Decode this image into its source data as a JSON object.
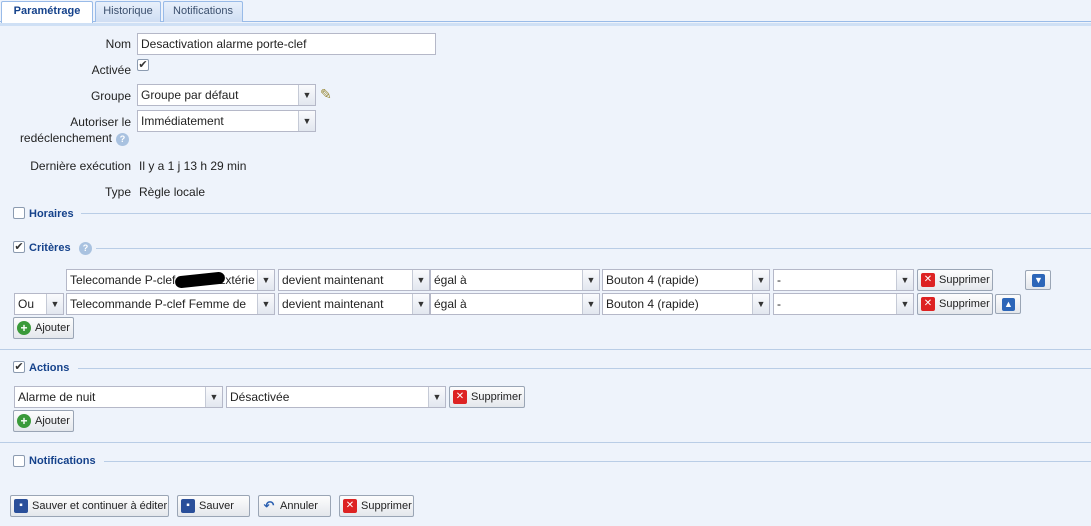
{
  "tabs": [
    "Paramétrage",
    "Historique",
    "Notifications"
  ],
  "form": {
    "name_label": "Nom",
    "name_value": "Desactivation alarme porte-clef",
    "active_label": "Activée",
    "active_checked": "✔",
    "group_label": "Groupe",
    "group_value": "Groupe par défaut",
    "retrigger_label_1": "Autoriser le",
    "retrigger_label_2": "redéclenchement",
    "retrigger_value": "Immédiatement",
    "last_exec_label": "Dernière exécution",
    "last_exec_value": "Il y a 1 j 13 h 29 min",
    "type_label": "Type",
    "type_value": "Règle locale"
  },
  "sections": {
    "horaires": "Horaires",
    "criteres": "Critères",
    "actions": "Actions",
    "notifications": "Notifications"
  },
  "criteria": [
    {
      "connector": "",
      "device_prefix": "Telecomande P-clef",
      "device_suffix": "Extérie",
      "condition": "devient maintenant",
      "operator": "égal à",
      "value": "Bouton 4 (rapide)",
      "extra": "-",
      "delete": "Supprimer"
    },
    {
      "connector": "Ou",
      "device": "Telecommande P-clef Femme de",
      "condition": "devient maintenant",
      "operator": "égal à",
      "value": "Bouton 4 (rapide)",
      "extra": "-",
      "delete": "Supprimer"
    }
  ],
  "add_label": "Ajouter",
  "actions": [
    {
      "target": "Alarme de nuit",
      "value": "Désactivée",
      "delete": "Supprimer"
    }
  ],
  "footer": {
    "save_continue": "Sauver et continuer à éditer",
    "save": "Sauver",
    "cancel": "Annuler",
    "delete": "Supprimer"
  },
  "icons": {
    "dropdown": "chevron-down",
    "help": "?",
    "move_down": "arrow-down",
    "move_up": "arrow-up"
  }
}
